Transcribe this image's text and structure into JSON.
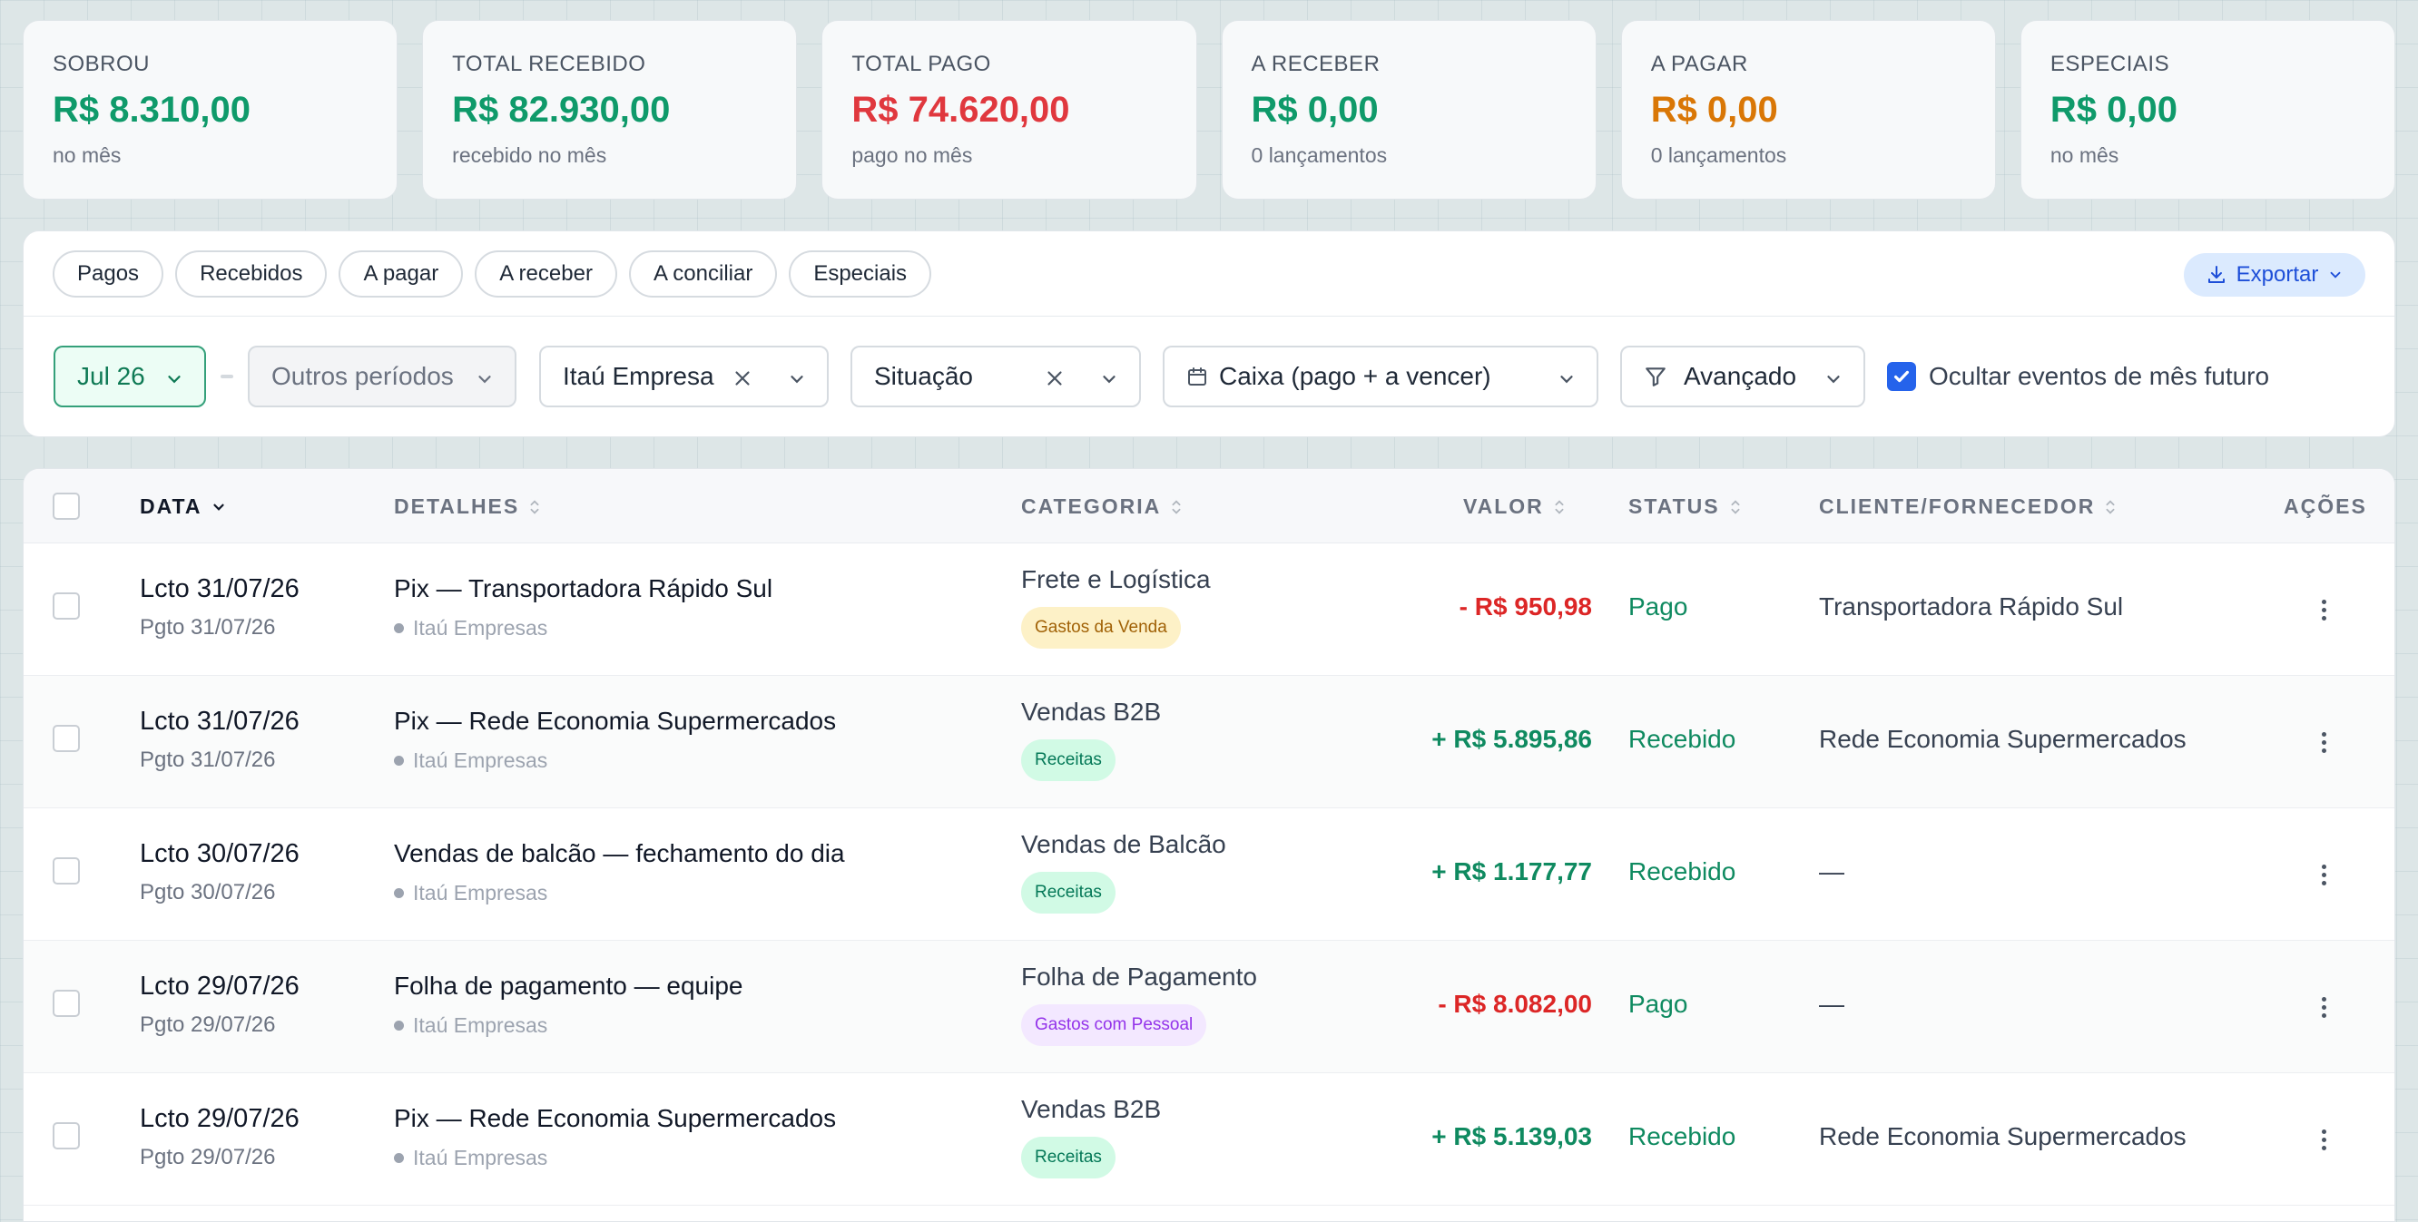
{
  "summary": [
    {
      "label": "SOBROU",
      "value": "R$ 8.310,00",
      "sub": "no mês",
      "color": "#0f9a6a"
    },
    {
      "label": "TOTAL RECEBIDO",
      "value": "R$ 82.930,00",
      "sub": "recebido no mês",
      "color": "#0f9a6a"
    },
    {
      "label": "TOTAL PAGO",
      "value": "R$ 74.620,00",
      "sub": "pago no mês",
      "color": "#e0383e"
    },
    {
      "label": "A RECEBER",
      "value": "R$ 0,00",
      "sub": "0 lançamentos",
      "color": "#0f9a6a"
    },
    {
      "label": "A PAGAR",
      "value": "R$ 0,00",
      "sub": "0 lançamentos",
      "color": "#d97706"
    },
    {
      "label": "ESPECIAIS",
      "value": "R$ 0,00",
      "sub": "no mês",
      "color": "#0f9a6a"
    }
  ],
  "quick_filters": [
    "Pagos",
    "Recebidos",
    "A pagar",
    "A receber",
    "A conciliar",
    "Especiais"
  ],
  "export_label": "Exportar",
  "controls": {
    "period": "Jul 26",
    "other_periods": "Outros períodos",
    "account": "Itaú Empresa",
    "situation": "Situação",
    "mode": "Caixa (pago + a vencer)",
    "advanced": "Avançado",
    "hide_future_label": "Ocultar eventos de mês futuro",
    "hide_future_checked": true
  },
  "table": {
    "headers": {
      "data": "DATA",
      "detalhes": "DETALHES",
      "categoria": "CATEGORIA",
      "valor": "VALOR",
      "status": "STATUS",
      "cliente": "CLIENTE/FORNECEDOR",
      "acoes": "AÇÕES"
    },
    "rows": [
      {
        "lcto": "Lcto 31/07/26",
        "pgto": "Pgto 31/07/26",
        "title": "Pix — Transportadora Rápido Sul",
        "bank": "Itaú Empresas",
        "category": "Frete e Logística",
        "badge": "Gastos da Venda",
        "badge_bg": "#fdf1c7",
        "badge_fg": "#a16207",
        "value": "- R$ 950,98",
        "value_color": "#dc2626",
        "status": "Pago",
        "status_color": "#0f8a60",
        "client": "Transportadora Rápido Sul"
      },
      {
        "lcto": "Lcto 31/07/26",
        "pgto": "Pgto 31/07/26",
        "title": "Pix — Rede Economia Supermercados",
        "bank": "Itaú Empresas",
        "category": "Vendas B2B",
        "badge": "Receitas",
        "badge_bg": "#d1fae5",
        "badge_fg": "#047857",
        "value": "+ R$ 5.895,86",
        "value_color": "#0f8a60",
        "status": "Recebido",
        "status_color": "#0f8a60",
        "client": "Rede Economia Supermercados"
      },
      {
        "lcto": "Lcto 30/07/26",
        "pgto": "Pgto 30/07/26",
        "title": "Vendas de balcão — fechamento do dia",
        "bank": "Itaú Empresas",
        "category": "Vendas de Balcão",
        "badge": "Receitas",
        "badge_bg": "#d1fae5",
        "badge_fg": "#047857",
        "value": "+ R$ 1.177,77",
        "value_color": "#0f8a60",
        "status": "Recebido",
        "status_color": "#0f8a60",
        "client": "—"
      },
      {
        "lcto": "Lcto 29/07/26",
        "pgto": "Pgto 29/07/26",
        "title": "Folha de pagamento — equipe",
        "bank": "Itaú Empresas",
        "category": "Folha de Pagamento",
        "badge": "Gastos com Pessoal",
        "badge_bg": "#f3e8ff",
        "badge_fg": "#9333ea",
        "value": "- R$ 8.082,00",
        "value_color": "#dc2626",
        "status": "Pago",
        "status_color": "#0f8a60",
        "client": "—"
      },
      {
        "lcto": "Lcto 29/07/26",
        "pgto": "Pgto 29/07/26",
        "title": "Pix — Rede Economia Supermercados",
        "bank": "Itaú Empresas",
        "category": "Vendas B2B",
        "badge": "Receitas",
        "badge_bg": "#d1fae5",
        "badge_fg": "#047857",
        "value": "+ R$ 5.139,03",
        "value_color": "#0f8a60",
        "status": "Recebido",
        "status_color": "#0f8a60",
        "client": "Rede Economia Supermercados"
      }
    ]
  }
}
